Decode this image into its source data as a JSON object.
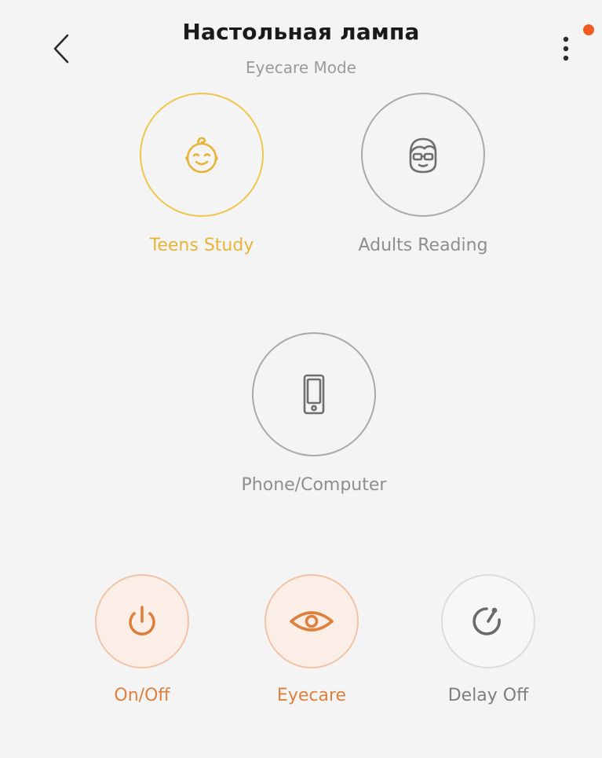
{
  "header": {
    "title": "Настольная лампа",
    "subtitle": "Eyecare Mode"
  },
  "modes": [
    {
      "label": "Teens Study",
      "icon": "baby-face-icon",
      "active": true
    },
    {
      "label": "Adults Reading",
      "icon": "glasses-face-icon",
      "active": false
    },
    {
      "label": "Phone/Computer",
      "icon": "phone-icon",
      "active": false
    }
  ],
  "controls": [
    {
      "label": "On/Off",
      "icon": "power-icon",
      "active": true
    },
    {
      "label": "Eyecare",
      "icon": "eye-icon",
      "active": true
    },
    {
      "label": "Delay Off",
      "icon": "timer-icon",
      "active": false
    }
  ],
  "colors": {
    "active_mode": "#e8b437",
    "active_control": "#df7f3c",
    "notification": "#f05a1c",
    "inactive": "#8e8e8e"
  }
}
